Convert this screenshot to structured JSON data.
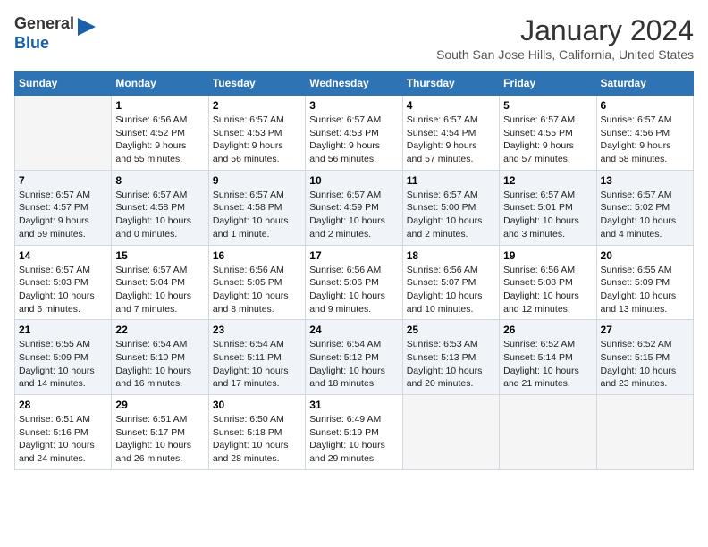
{
  "header": {
    "logo_line1": "General",
    "logo_line2": "Blue",
    "title": "January 2024",
    "subtitle": "South San Jose Hills, California, United States"
  },
  "calendar": {
    "days_of_week": [
      "Sunday",
      "Monday",
      "Tuesday",
      "Wednesday",
      "Thursday",
      "Friday",
      "Saturday"
    ],
    "weeks": [
      [
        {
          "day": "",
          "info": ""
        },
        {
          "day": "1",
          "info": "Sunrise: 6:56 AM\nSunset: 4:52 PM\nDaylight: 9 hours\nand 55 minutes."
        },
        {
          "day": "2",
          "info": "Sunrise: 6:57 AM\nSunset: 4:53 PM\nDaylight: 9 hours\nand 56 minutes."
        },
        {
          "day": "3",
          "info": "Sunrise: 6:57 AM\nSunset: 4:53 PM\nDaylight: 9 hours\nand 56 minutes."
        },
        {
          "day": "4",
          "info": "Sunrise: 6:57 AM\nSunset: 4:54 PM\nDaylight: 9 hours\nand 57 minutes."
        },
        {
          "day": "5",
          "info": "Sunrise: 6:57 AM\nSunset: 4:55 PM\nDaylight: 9 hours\nand 57 minutes."
        },
        {
          "day": "6",
          "info": "Sunrise: 6:57 AM\nSunset: 4:56 PM\nDaylight: 9 hours\nand 58 minutes."
        }
      ],
      [
        {
          "day": "7",
          "info": "Sunrise: 6:57 AM\nSunset: 4:57 PM\nDaylight: 9 hours\nand 59 minutes."
        },
        {
          "day": "8",
          "info": "Sunrise: 6:57 AM\nSunset: 4:58 PM\nDaylight: 10 hours\nand 0 minutes."
        },
        {
          "day": "9",
          "info": "Sunrise: 6:57 AM\nSunset: 4:58 PM\nDaylight: 10 hours\nand 1 minute."
        },
        {
          "day": "10",
          "info": "Sunrise: 6:57 AM\nSunset: 4:59 PM\nDaylight: 10 hours\nand 2 minutes."
        },
        {
          "day": "11",
          "info": "Sunrise: 6:57 AM\nSunset: 5:00 PM\nDaylight: 10 hours\nand 2 minutes."
        },
        {
          "day": "12",
          "info": "Sunrise: 6:57 AM\nSunset: 5:01 PM\nDaylight: 10 hours\nand 3 minutes."
        },
        {
          "day": "13",
          "info": "Sunrise: 6:57 AM\nSunset: 5:02 PM\nDaylight: 10 hours\nand 4 minutes."
        }
      ],
      [
        {
          "day": "14",
          "info": "Sunrise: 6:57 AM\nSunset: 5:03 PM\nDaylight: 10 hours\nand 6 minutes."
        },
        {
          "day": "15",
          "info": "Sunrise: 6:57 AM\nSunset: 5:04 PM\nDaylight: 10 hours\nand 7 minutes."
        },
        {
          "day": "16",
          "info": "Sunrise: 6:56 AM\nSunset: 5:05 PM\nDaylight: 10 hours\nand 8 minutes."
        },
        {
          "day": "17",
          "info": "Sunrise: 6:56 AM\nSunset: 5:06 PM\nDaylight: 10 hours\nand 9 minutes."
        },
        {
          "day": "18",
          "info": "Sunrise: 6:56 AM\nSunset: 5:07 PM\nDaylight: 10 hours\nand 10 minutes."
        },
        {
          "day": "19",
          "info": "Sunrise: 6:56 AM\nSunset: 5:08 PM\nDaylight: 10 hours\nand 12 minutes."
        },
        {
          "day": "20",
          "info": "Sunrise: 6:55 AM\nSunset: 5:09 PM\nDaylight: 10 hours\nand 13 minutes."
        }
      ],
      [
        {
          "day": "21",
          "info": "Sunrise: 6:55 AM\nSunset: 5:09 PM\nDaylight: 10 hours\nand 14 minutes."
        },
        {
          "day": "22",
          "info": "Sunrise: 6:54 AM\nSunset: 5:10 PM\nDaylight: 10 hours\nand 16 minutes."
        },
        {
          "day": "23",
          "info": "Sunrise: 6:54 AM\nSunset: 5:11 PM\nDaylight: 10 hours\nand 17 minutes."
        },
        {
          "day": "24",
          "info": "Sunrise: 6:54 AM\nSunset: 5:12 PM\nDaylight: 10 hours\nand 18 minutes."
        },
        {
          "day": "25",
          "info": "Sunrise: 6:53 AM\nSunset: 5:13 PM\nDaylight: 10 hours\nand 20 minutes."
        },
        {
          "day": "26",
          "info": "Sunrise: 6:52 AM\nSunset: 5:14 PM\nDaylight: 10 hours\nand 21 minutes."
        },
        {
          "day": "27",
          "info": "Sunrise: 6:52 AM\nSunset: 5:15 PM\nDaylight: 10 hours\nand 23 minutes."
        }
      ],
      [
        {
          "day": "28",
          "info": "Sunrise: 6:51 AM\nSunset: 5:16 PM\nDaylight: 10 hours\nand 24 minutes."
        },
        {
          "day": "29",
          "info": "Sunrise: 6:51 AM\nSunset: 5:17 PM\nDaylight: 10 hours\nand 26 minutes."
        },
        {
          "day": "30",
          "info": "Sunrise: 6:50 AM\nSunset: 5:18 PM\nDaylight: 10 hours\nand 28 minutes."
        },
        {
          "day": "31",
          "info": "Sunrise: 6:49 AM\nSunset: 5:19 PM\nDaylight: 10 hours\nand 29 minutes."
        },
        {
          "day": "",
          "info": ""
        },
        {
          "day": "",
          "info": ""
        },
        {
          "day": "",
          "info": ""
        }
      ]
    ]
  }
}
